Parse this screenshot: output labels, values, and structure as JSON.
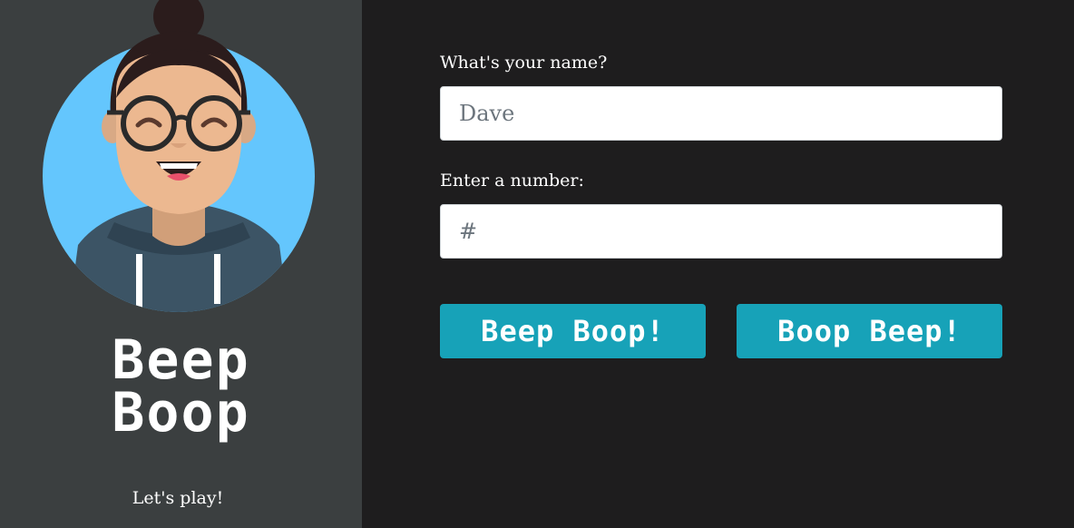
{
  "sidebar": {
    "title_line1": "Beep",
    "title_line2": "Boop",
    "tagline": "Let's play!"
  },
  "form": {
    "name_label": "What's your name?",
    "name_placeholder": "Dave",
    "number_label": "Enter a number:",
    "number_placeholder": "#"
  },
  "buttons": {
    "beep_boop": "Beep Boop!",
    "boop_beep": "Boop Beep!"
  },
  "colors": {
    "sidebar_bg": "#3b3f40",
    "main_bg": "#1e1d1e",
    "button": "#17a2b8",
    "avatar_bg": "#64c6fd"
  }
}
